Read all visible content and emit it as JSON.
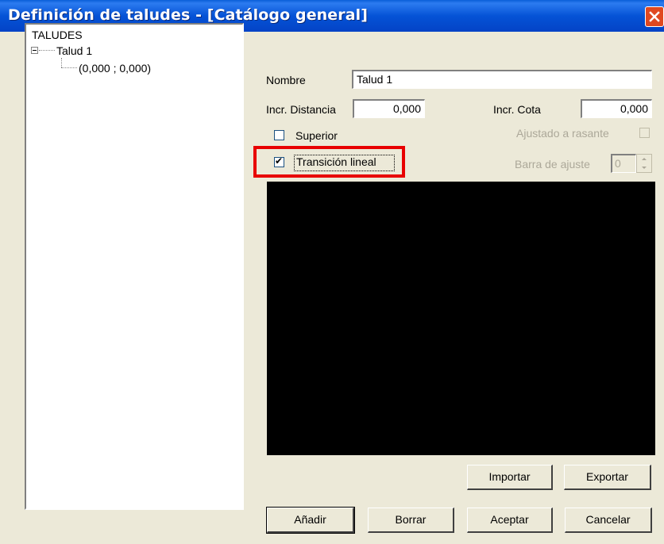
{
  "window": {
    "title": "Definición de taludes - [Catálogo general]",
    "close_icon": "close-icon",
    "close_color": "#E04820"
  },
  "tree": {
    "root": "TALUDES",
    "items": [
      {
        "label": "Talud 1",
        "children": [
          "(0,000 ; 0,000)"
        ]
      }
    ]
  },
  "form": {
    "nombre_label": "Nombre",
    "nombre_value": "Talud 1",
    "incr_distancia_label": "Incr. Distancia",
    "incr_distancia_value": "0,000",
    "incr_cota_label": "Incr. Cota",
    "incr_cota_value": "0,000",
    "superior_label": "Superior",
    "superior_checked": false,
    "ajustado_label": "Ajustado a rasante",
    "ajustado_checked": false,
    "transicion_label": "Transición lineal",
    "transicion_checked": true,
    "barra_label": "Barra de ajuste",
    "barra_value": "0"
  },
  "buttons": {
    "importar": "Importar",
    "exportar": "Exportar",
    "anadir": "Añadir",
    "borrar": "Borrar",
    "aceptar": "Aceptar",
    "cancelar": "Cancelar"
  },
  "colors": {
    "titlebar": "#0553D6",
    "highlight": "#E80000",
    "preview_bg": "#000000"
  }
}
